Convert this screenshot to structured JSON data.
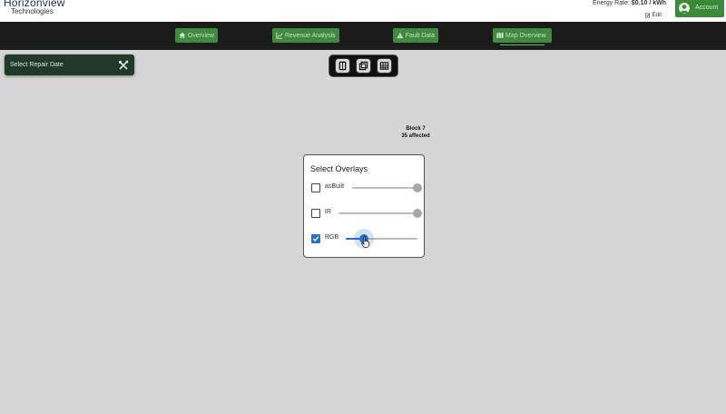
{
  "header": {
    "logo_line1": "Horizonview",
    "logo_line2": "Technologies",
    "energy_rate_label": "Energy Rate:",
    "energy_rate_value": "$0.10 / kWh",
    "edit_label": "Edit",
    "account_label": "Account"
  },
  "nav": {
    "tabs": [
      {
        "label": "Overview",
        "icon": "home-icon"
      },
      {
        "label": "Revenue Analysis",
        "icon": "chart-icon"
      },
      {
        "label": "Fault Data",
        "icon": "warning-icon"
      },
      {
        "label": "Map Overview",
        "icon": "map-icon",
        "active": true
      }
    ]
  },
  "repair_panel": {
    "label": "Select Repair Date",
    "icon": "tools-icon"
  },
  "layer_toolbar": {
    "buttons": [
      "map-layer-icon",
      "overlay-layer-icon",
      "grid-layer-icon"
    ]
  },
  "map": {
    "block_name": "Block 7",
    "block_affected": "35 affected"
  },
  "overlays": {
    "title": "Select Overlays",
    "items": [
      {
        "label": "asBuilt",
        "checked": false,
        "opacity": 1.0
      },
      {
        "label": "IR",
        "checked": false,
        "opacity": 1.0
      },
      {
        "label": "RGB",
        "checked": true,
        "opacity": 0.25
      }
    ]
  },
  "colors": {
    "accent_green": "#3f8a3f",
    "nav_bg": "#1b1b1b",
    "slider_blue": "#2a6fcf",
    "map_bg": "#d6d6d6"
  }
}
